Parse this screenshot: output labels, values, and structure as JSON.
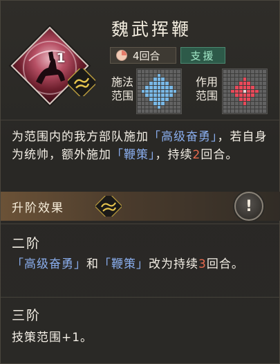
{
  "skill": {
    "level": "1",
    "name": "魏武挥鞭",
    "duration_label": "4回合",
    "type_label": "支援",
    "cast_range_label_1": "施法",
    "cast_range_label_2": "范围",
    "effect_range_label_1": "作用",
    "effect_range_label_2": "范围",
    "icons": [
      "unit-portrait",
      "dragon-emblem-icon",
      "clock-icon"
    ]
  },
  "description": {
    "p1": "为范围内的我方部队施加",
    "kw1": "「高级奋勇」",
    "p2": "，若自身为统帅，额外施加",
    "kw2": "「鞭策」",
    "p3": "，持续",
    "n1": "2",
    "p4": "回合。"
  },
  "upgrade": {
    "title": "升阶效果",
    "info_icon": "info-exclamation-icon",
    "tier2": {
      "title": "二阶",
      "kw1": "「高级奋勇」",
      "p1": "和",
      "kw2": "「鞭策」",
      "p2": "改为持续",
      "n1": "3",
      "p3": "回合。"
    },
    "tier3": {
      "title": "三阶",
      "text": "技策范围+1。"
    }
  },
  "colors": {
    "keyword": "#8aaeee",
    "number": "#e86a4e",
    "cast_range": "#79b8e6",
    "effect_range": "#e9495a",
    "support_tag": "#2d5a49"
  }
}
